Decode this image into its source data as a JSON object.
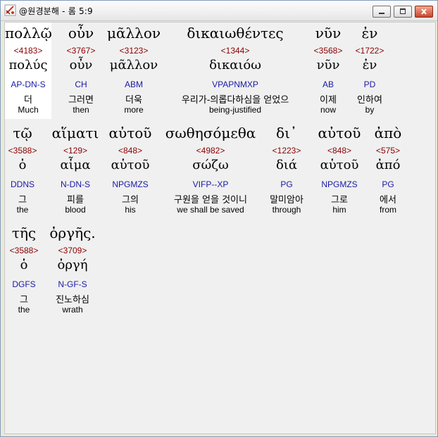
{
  "window": {
    "title": "@원경분해 - 롬 5:9"
  },
  "colors": {
    "strongs": "#8b0000",
    "morph": "#1a1aa6",
    "text": "#000000",
    "background": "#f0f0f0",
    "selected": "#ffffff"
  },
  "words": [
    {
      "greek": "πολλῷ",
      "strongs": "<4183>",
      "lemma": "πολύς",
      "morph": "AP-DN-S",
      "korean": "더",
      "english": "Much"
    },
    {
      "greek": "οὖν",
      "strongs": "<3767>",
      "lemma": "οὖν",
      "morph": "CH",
      "korean": "그러면",
      "english": "then"
    },
    {
      "greek": "μᾶλλον",
      "strongs": "<3123>",
      "lemma": "μᾶλλον",
      "morph": "ABM",
      "korean": "더욱",
      "english": "more"
    },
    {
      "greek": "δικαιωθέντες",
      "strongs": "<1344>",
      "lemma": "δικαιόω",
      "morph": "VPAPNMXP",
      "korean": "우리가-의롭다하심을 얻었으",
      "english": "being-justified"
    },
    {
      "greek": "νῦν",
      "strongs": "<3568>",
      "lemma": "νῦν",
      "morph": "AB",
      "korean": "이제",
      "english": "now"
    },
    {
      "greek": "ἐν",
      "strongs": "<1722>",
      "lemma": "ἐν",
      "morph": "PD",
      "korean": "인하여",
      "english": "by"
    },
    {
      "greek": "τῷ",
      "strongs": "<3588>",
      "lemma": "ὁ",
      "morph": "DDNS",
      "korean": "그",
      "english": "the"
    },
    {
      "greek": "αἵματι",
      "strongs": "<129>",
      "lemma": "αἷμα",
      "morph": "N-DN-S",
      "korean": "피를",
      "english": "blood"
    },
    {
      "greek": "αὐτοῦ",
      "strongs": "<848>",
      "lemma": "αὑτοῦ",
      "morph": "NPGMZS",
      "korean": "그의",
      "english": "his"
    },
    {
      "greek": "σωθησόμεθα",
      "strongs": "<4982>",
      "lemma": "σώζω",
      "morph": "VIFP--XP",
      "korean": "구원을 얻을 것이니",
      "english": "we shall be saved"
    },
    {
      "greek": "δι᾽",
      "strongs": "<1223>",
      "lemma": "διά",
      "morph": "PG",
      "korean": "말미암아",
      "english": "through"
    },
    {
      "greek": "αὐτοῦ",
      "strongs": "<848>",
      "lemma": "αὑτοῦ",
      "morph": "NPGMZS",
      "korean": "그로",
      "english": "him"
    },
    {
      "greek": "ἀπὸ",
      "strongs": "<575>",
      "lemma": "ἀπό",
      "morph": "PG",
      "korean": "에서",
      "english": "from"
    },
    {
      "greek": "τῆς",
      "strongs": "<3588>",
      "lemma": "ὁ",
      "morph": "DGFS",
      "korean": "그",
      "english": "the"
    },
    {
      "greek": "ὀργῆς.",
      "strongs": "<3709>",
      "lemma": "ὀργή",
      "morph": "N-GF-S",
      "korean": "진노하심",
      "english": "wrath"
    }
  ]
}
